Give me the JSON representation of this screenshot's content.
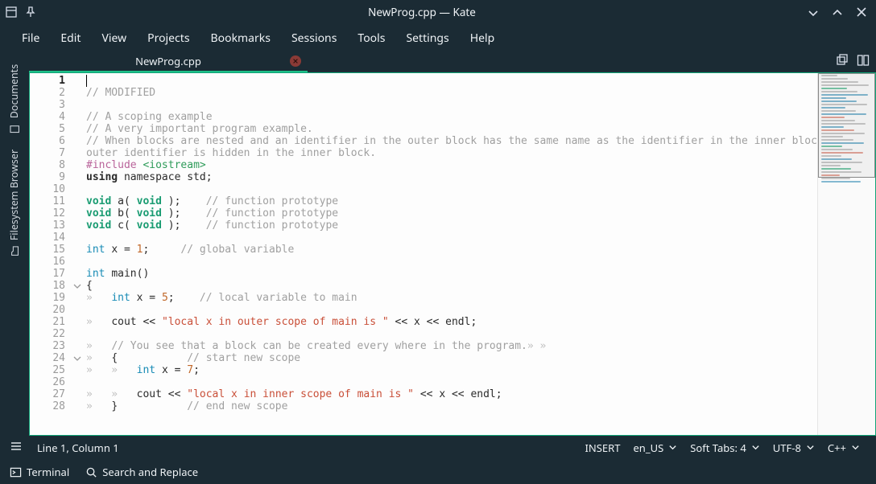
{
  "titlebar": {
    "title": "NewProg.cpp — Kate"
  },
  "menu": {
    "items": [
      "File",
      "Edit",
      "View",
      "Projects",
      "Bookmarks",
      "Sessions",
      "Tools",
      "Settings",
      "Help"
    ]
  },
  "sidetabs": {
    "documents": "Documents",
    "filesystem": "Filesystem Browser"
  },
  "tab": {
    "label": "NewProg.cpp"
  },
  "code": {
    "lines": [
      {
        "n": 1,
        "segs": []
      },
      {
        "n": 2,
        "segs": [
          [
            "c-cm",
            "// MODIFIED"
          ]
        ]
      },
      {
        "n": 3,
        "segs": []
      },
      {
        "n": 4,
        "segs": [
          [
            "c-cm",
            "// A scoping example"
          ]
        ]
      },
      {
        "n": 5,
        "segs": [
          [
            "c-cm",
            "// A very important program example."
          ]
        ]
      },
      {
        "n": 6,
        "segs": [
          [
            "c-cm",
            "// When blocks are nested and an identifier in the outer block has the same name as the identifier in the inner block then the"
          ]
        ]
      },
      {
        "n": 7,
        "segs": [
          [
            "c-cm",
            "outer identifier is hidden in the inner block."
          ]
        ]
      },
      {
        "n": 8,
        "segs": [
          [
            "c-pp",
            "#include "
          ],
          [
            "c-inc",
            "<iostream>"
          ]
        ]
      },
      {
        "n": 9,
        "segs": [
          [
            "c-kw",
            "using "
          ],
          [
            "",
            "namespace std;"
          ]
        ]
      },
      {
        "n": 10,
        "segs": []
      },
      {
        "n": 11,
        "segs": [
          [
            "c-vd",
            "void "
          ],
          [
            "",
            "a( "
          ],
          [
            "c-vd",
            "void "
          ],
          [
            "",
            ");    "
          ],
          [
            "c-cm",
            "// function prototype"
          ]
        ]
      },
      {
        "n": 12,
        "segs": [
          [
            "c-vd",
            "void "
          ],
          [
            "",
            "b( "
          ],
          [
            "c-vd",
            "void "
          ],
          [
            "",
            ");    "
          ],
          [
            "c-cm",
            "// function prototype"
          ]
        ]
      },
      {
        "n": 13,
        "segs": [
          [
            "c-vd",
            "void "
          ],
          [
            "",
            "c( "
          ],
          [
            "c-vd",
            "void "
          ],
          [
            "",
            ");    "
          ],
          [
            "c-cm",
            "// function prototype"
          ]
        ]
      },
      {
        "n": 14,
        "segs": []
      },
      {
        "n": 15,
        "segs": [
          [
            "c-ty",
            "int "
          ],
          [
            "",
            "x = "
          ],
          [
            "c-num",
            "1"
          ],
          [
            "",
            ";     "
          ],
          [
            "c-cm",
            "// global variable"
          ]
        ]
      },
      {
        "n": 16,
        "segs": []
      },
      {
        "n": 17,
        "segs": [
          [
            "c-ty",
            "int "
          ],
          [
            "",
            "main()"
          ]
        ]
      },
      {
        "n": 18,
        "fold": true,
        "segs": [
          [
            "",
            "{"
          ]
        ]
      },
      {
        "n": 19,
        "segs": [
          [
            "fold-guide",
            "»   "
          ],
          [
            "c-ty",
            "int "
          ],
          [
            "",
            "x = "
          ],
          [
            "c-num",
            "5"
          ],
          [
            "",
            ";    "
          ],
          [
            "c-cm",
            "// local variable to main"
          ]
        ]
      },
      {
        "n": 20,
        "segs": []
      },
      {
        "n": 21,
        "segs": [
          [
            "fold-guide",
            "»   "
          ],
          [
            "",
            "cout << "
          ],
          [
            "c-str",
            "\"local x in outer scope of main is \""
          ],
          [
            "",
            " << x << endl;"
          ]
        ]
      },
      {
        "n": 22,
        "segs": []
      },
      {
        "n": 23,
        "segs": [
          [
            "fold-guide",
            "»   "
          ],
          [
            "c-cm",
            "// You see that a block can be created every where in the program."
          ],
          [
            "fold-guide",
            "» »"
          ]
        ]
      },
      {
        "n": 24,
        "fold": true,
        "segs": [
          [
            "fold-guide",
            "»   "
          ],
          [
            "",
            "{           "
          ],
          [
            "c-cm",
            "// start new scope"
          ]
        ]
      },
      {
        "n": 25,
        "segs": [
          [
            "fold-guide",
            "»   »   "
          ],
          [
            "c-ty",
            "int "
          ],
          [
            "",
            "x = "
          ],
          [
            "c-num",
            "7"
          ],
          [
            "",
            ";"
          ]
        ]
      },
      {
        "n": 26,
        "segs": []
      },
      {
        "n": 27,
        "segs": [
          [
            "fold-guide",
            "»   »   "
          ],
          [
            "",
            "cout << "
          ],
          [
            "c-str",
            "\"local x in inner scope of main is \""
          ],
          [
            "",
            " << x << endl;"
          ]
        ]
      },
      {
        "n": 28,
        "segs": [
          [
            "fold-guide",
            "»   "
          ],
          [
            "",
            "}           "
          ],
          [
            "c-cm",
            "// end new scope"
          ]
        ]
      }
    ]
  },
  "status": {
    "position": "Line 1, Column 1",
    "mode": "INSERT",
    "dict": "en_US",
    "indent": "Soft Tabs: 4",
    "encoding": "UTF-8",
    "lang": "C++"
  },
  "bottom": {
    "terminal": "Terminal",
    "search": "Search and Replace"
  }
}
